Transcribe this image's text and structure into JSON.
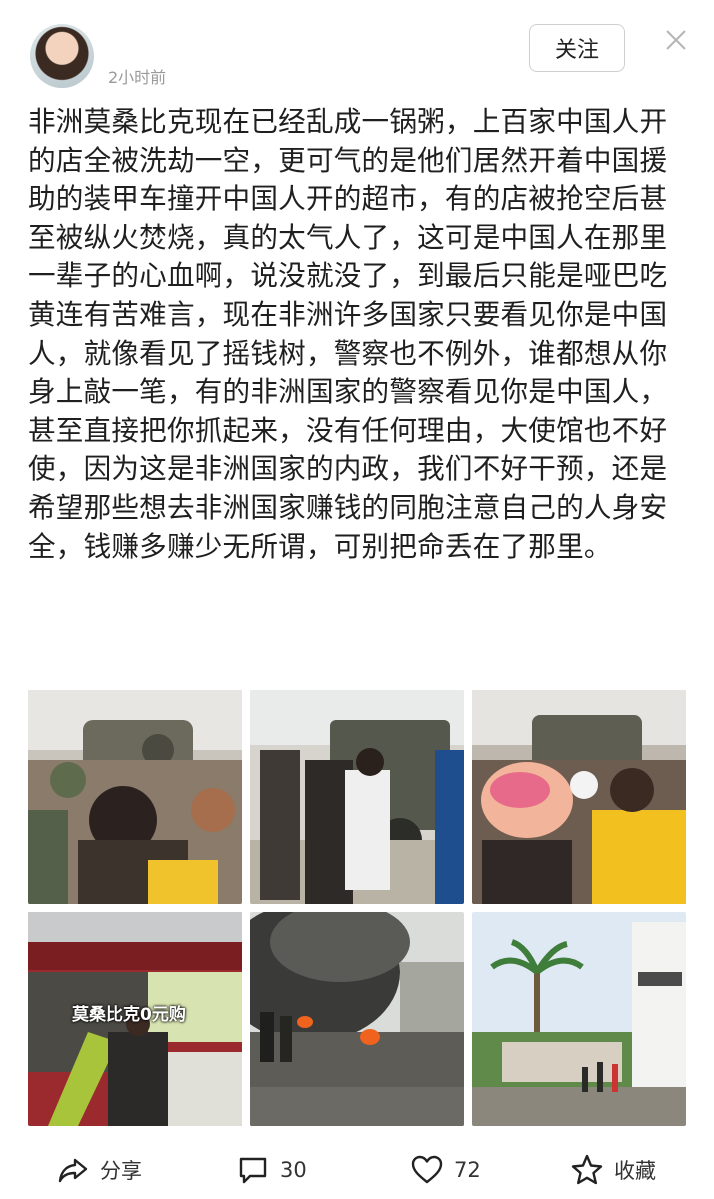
{
  "header": {
    "time": "2小时前",
    "follow_label": "关注"
  },
  "post": {
    "text": "非洲莫桑比克现在已经乱成一锅粥，上百家中国人开的店全被洗劫一空，更可气的是他们居然开着中国援助的装甲车撞开中国人开的超市，有的店被抢空后甚至被纵火焚烧，真的太气人了，这可是中国人在那里一辈子的心血啊，说没就没了，到最后只能是哑巴吃黄连有苦难言，现在非洲许多国家只要看见你是中国人，就像看见了摇钱树，警察也不例外，谁都想从你身上敲一笔，有的非洲国家的警察看见你是中国人，甚至直接把你抓起来，没有任何理由，大使馆也不好使，因为这是非洲国家的内政，我们不好干预，还是希望那些想去非洲国家赚钱的同胞注意自己的人身安全，钱赚多赚少无所谓，可别把命丢在了那里。"
  },
  "images": {
    "overlay_text": "莫桑比克0元购"
  },
  "actions": {
    "share_label": "分享",
    "comment_count": "30",
    "like_count": "72",
    "favorite_label": "收藏"
  }
}
